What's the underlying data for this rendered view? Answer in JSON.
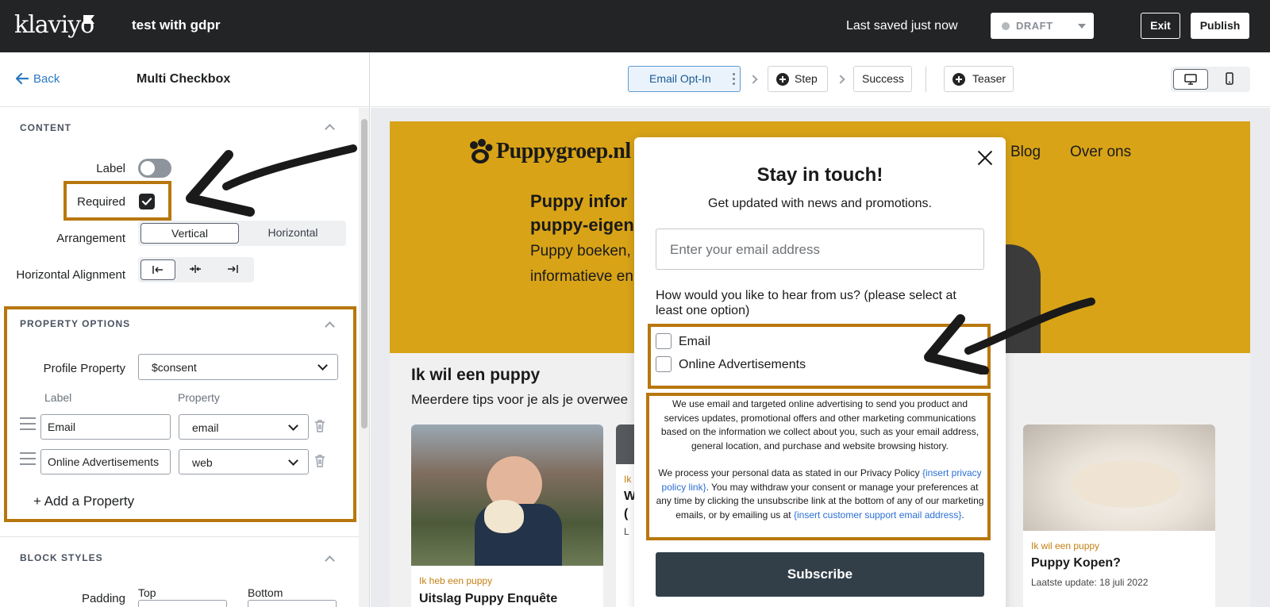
{
  "topbar": {
    "logo": "klaviyo",
    "form_name": "test with gdpr",
    "saved_status": "Last saved just now",
    "status": "DRAFT",
    "exit_label": "Exit",
    "publish_label": "Publish"
  },
  "panel": {
    "back_label": "Back",
    "title": "Multi Checkbox",
    "content": {
      "section_title": "CONTENT",
      "label_text": "Label",
      "label_toggle_on": false,
      "required_text": "Required",
      "required_checked": true,
      "arrangement_text": "Arrangement",
      "arrangement_options": [
        "Vertical",
        "Horizontal"
      ],
      "arrangement_selected": "Vertical",
      "h_align_text": "Horizontal Alignment",
      "h_align_icons": [
        "align-left-icon",
        "align-center-icon",
        "align-right-icon"
      ]
    },
    "property_options": {
      "section_title": "PROPERTY OPTIONS",
      "profile_property_text": "Profile Property",
      "profile_property_value": "$consent",
      "col_label": "Label",
      "col_property": "Property",
      "rows": [
        {
          "label": "Email",
          "property": "email"
        },
        {
          "label": "Online Advertisements",
          "property": "web"
        }
      ],
      "add_label": "+ Add a Property"
    },
    "block_styles": {
      "section_title": "BLOCK STYLES",
      "padding_text": "Padding",
      "top_text": "Top",
      "bottom_text": "Bottom"
    }
  },
  "editor": {
    "steps": [
      {
        "label": "Email Opt-In",
        "active": true
      },
      {
        "label": "Step",
        "active": false
      },
      {
        "label": "Success",
        "active": false
      },
      {
        "label": "Teaser",
        "active": false
      }
    ],
    "device_icons": [
      "desktop-icon",
      "mobile-icon"
    ]
  },
  "site": {
    "logo": "Puppygroep.nl",
    "nav": [
      "Blog",
      "Over ons"
    ],
    "hero_heading_lines": [
      "Puppy infor",
      "puppy-eigen"
    ],
    "hero_text_lines": [
      "Puppy boeken,",
      "informatieve en"
    ],
    "section_heading": "Ik wil een puppy",
    "section_text": "Meerdere tips voor je als je overwee",
    "cards": [
      {
        "tag": "Ik heb een puppy",
        "title": "Uitslag Puppy Enquête",
        "meta": ""
      },
      {
        "tag": "Ik",
        "title": "W (",
        "meta": "L"
      },
      {
        "tag": "Ik wil een puppy",
        "title": "Puppy Kopen?",
        "meta": "Laatste update: 18 juli 2022"
      }
    ]
  },
  "popup": {
    "title": "Stay in touch!",
    "subtitle": "Get updated with news and promotions.",
    "email_placeholder": "Enter your email address",
    "question": "How would you like to hear from us? (please select at least one option)",
    "options": [
      "Email",
      "Online Advertisements"
    ],
    "legal_p1": "We use email and targeted online advertising to send you product and services updates, promotional offers and other marketing communications based on the information we collect about you, such as your email address, general location, and purchase and website browsing history.",
    "legal_p2_a": "We process your personal data as stated in our Privacy Policy ",
    "legal_p2_link1": "{insert privacy policy link}",
    "legal_p2_b": ". You may withdraw your consent or manage your preferences at any time by clicking the unsubscribe link at the bottom of any of our marketing emails, or by emailing us at ",
    "legal_p2_link2": "{insert customer support email address}",
    "legal_p2_c": ".",
    "subscribe_label": "Subscribe"
  },
  "colors": {
    "topbar_bg": "#232426",
    "highlight": "#b8770e",
    "site_hero": "#d8a317",
    "subscribe_bg": "#333f48",
    "link": "#2b79c2"
  }
}
